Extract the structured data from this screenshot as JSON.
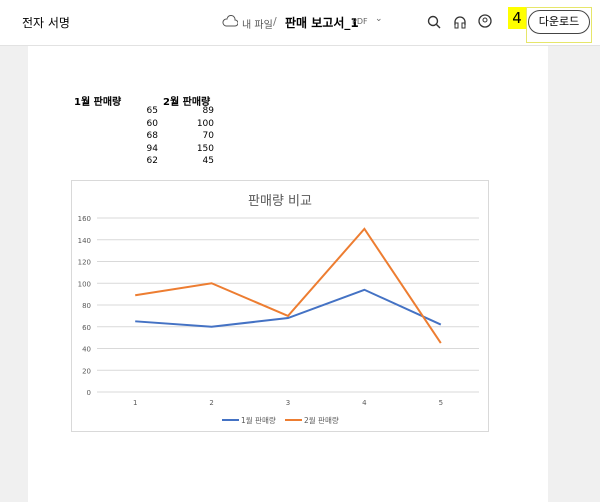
{
  "header": {
    "esign": "전자 서명",
    "my_files": "내 파일",
    "separator": "/",
    "file_name": "판매 보고서_1",
    "file_type": "PDF",
    "download": "다운로드",
    "annotation_badge": "4"
  },
  "table": {
    "headers": [
      "1월 판매량",
      "2월 판매량"
    ],
    "rows": [
      [
        "65",
        "89"
      ],
      [
        "60",
        "100"
      ],
      [
        "68",
        "70"
      ],
      [
        "94",
        "150"
      ],
      [
        "62",
        "45"
      ]
    ]
  },
  "chart_data": {
    "type": "line",
    "title": "판매량 비교",
    "categories": [
      "1",
      "2",
      "3",
      "4",
      "5"
    ],
    "series": [
      {
        "name": "1월 판매량",
        "values": [
          65,
          60,
          68,
          94,
          62
        ],
        "color": "#4472c4"
      },
      {
        "name": "2월 판매량",
        "values": [
          89,
          100,
          70,
          150,
          45
        ],
        "color": "#ed7d31"
      }
    ],
    "ylim": [
      0,
      160
    ],
    "yticks": [
      "0",
      "20",
      "40",
      "60",
      "80",
      "100",
      "120",
      "140",
      "160"
    ],
    "legend": "bottom",
    "grid": true
  }
}
